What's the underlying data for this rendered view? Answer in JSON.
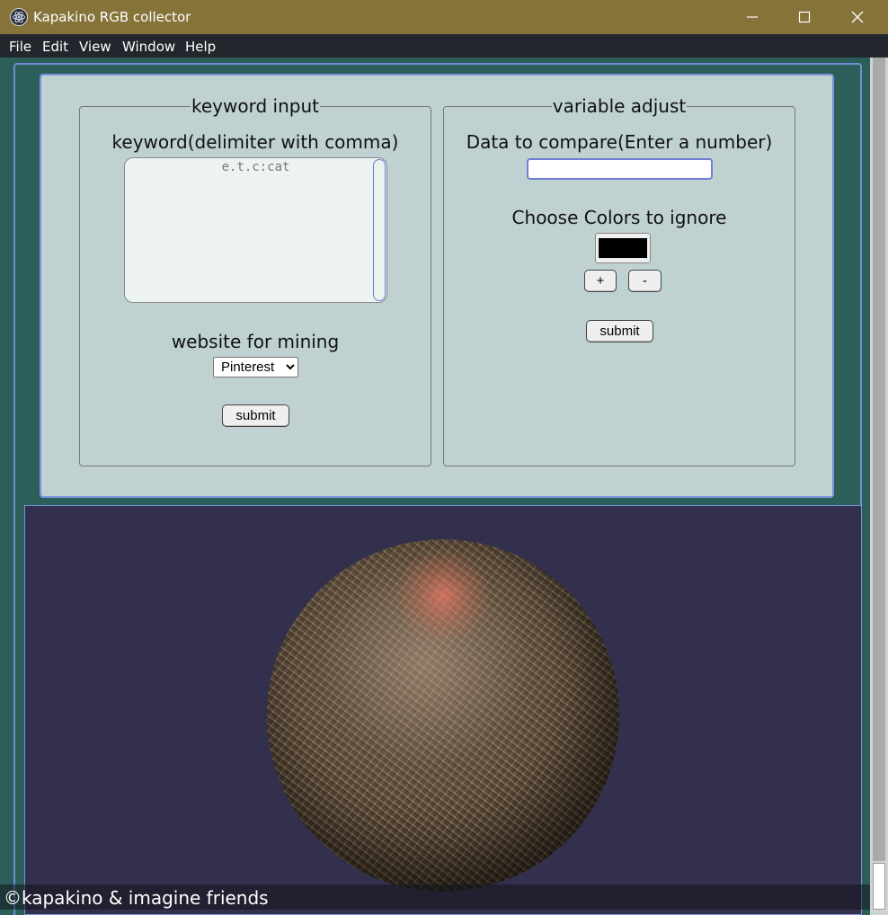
{
  "window": {
    "title": "Kapakino RGB collector"
  },
  "menu": {
    "items": [
      "File",
      "Edit",
      "View",
      "Window",
      "Help"
    ]
  },
  "keyword_box": {
    "legend": "keyword input",
    "keyword_label": "keyword(delimiter with comma)",
    "keyword_placeholder": "e.t.c:cat",
    "keyword_value": "",
    "website_label": "website for mining",
    "website_selected": "Pinterest",
    "submit_label": "submit"
  },
  "variable_box": {
    "legend": "variable adjust",
    "compare_label": "Data to compare(Enter a number)",
    "compare_value": "",
    "ignore_label": "Choose Colors to ignore",
    "ignore_color": "#000000",
    "add_label": "+",
    "remove_label": "-",
    "submit_label": "submit"
  },
  "footer": {
    "text": "©kapakino & imagine friends"
  },
  "colors": {
    "titlebar": "#86733a",
    "menubar": "#23262d",
    "page_bg": "#2c5f5a",
    "panel_bg": "#bfd1d1",
    "scene_bg": "#32304d",
    "accent_border": "#7a92e0"
  }
}
